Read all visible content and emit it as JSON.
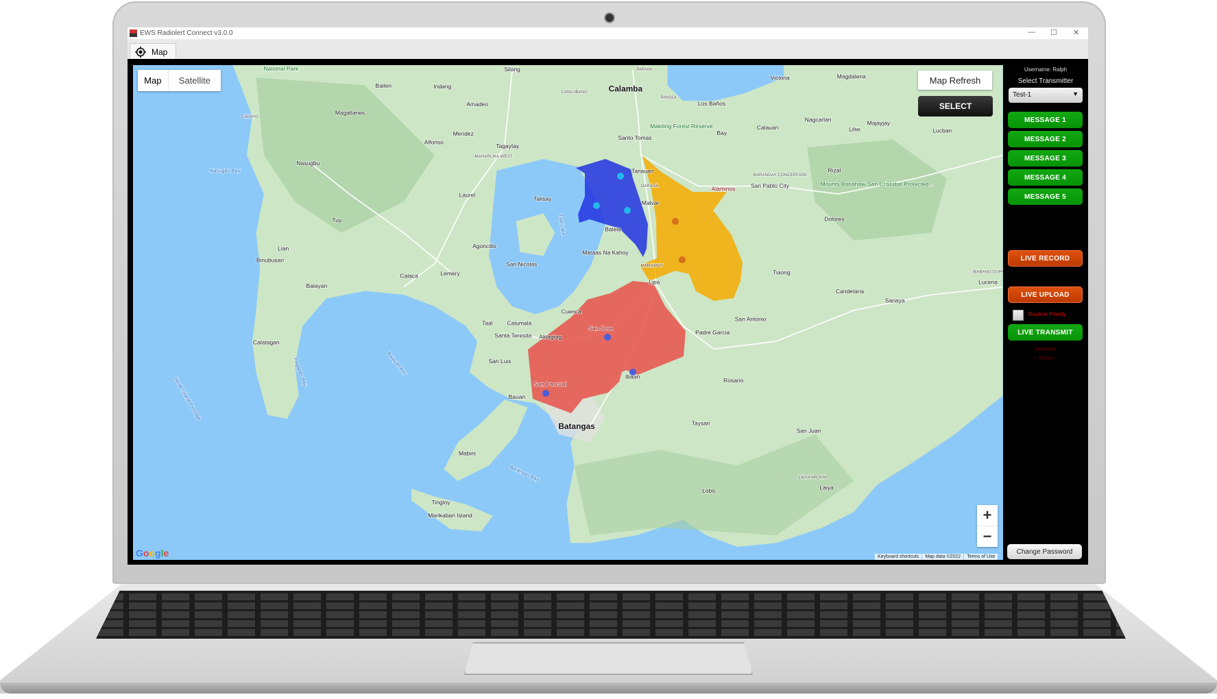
{
  "window": {
    "title": "EWS Radiolert Connect v3.0.0",
    "controls": {
      "minimize": "—",
      "maximize": "☐",
      "close": "✕"
    },
    "tabs": [
      {
        "label": "Map",
        "icon": "crosshair-target-icon",
        "active": true
      }
    ]
  },
  "map": {
    "type_control": {
      "map": "Map",
      "satellite": "Satellite",
      "selected": "Map"
    },
    "refresh_label": "Map Refresh",
    "select_label": "SELECT",
    "zoom_in": "+",
    "zoom_out": "−",
    "attribution": [
      "Keyboard shortcuts",
      "Map data ©2022",
      "Terms of Use"
    ],
    "provider_logo": "Google",
    "colors": {
      "water": "#8cc9f8",
      "land": "#cde6c6",
      "zone_blue": "#2233e0",
      "zone_orange": "#f5aa00",
      "zone_red": "#e8514a"
    },
    "labels": [
      "National Park",
      "Silang",
      "Bailen",
      "Indang",
      "Calamba",
      "PARIAN",
      "Victoria",
      "Magdalena",
      "PANSOL",
      "Los Baños",
      "CANLUBANG",
      "Amadeo",
      "Magallanes",
      "CALAYO",
      "Makiling Forest Reserve",
      "Bay",
      "Nagcarlan",
      "Majayjay",
      "Mendez",
      "Alfonso",
      "Tagaytay",
      "Santo Tomas",
      "Calauan",
      "Liliw",
      "Lucban",
      "MAHARLIKA WEST",
      "Nasugbu",
      "Nasugbu Bay",
      "Tanauan",
      "DARASA",
      "Alaminos",
      "BARANGAY CONCEPCION",
      "San Pablo City",
      "Rizal",
      "Mounts Banahaw-San Cristobal Protected...",
      "Laurel",
      "Talisay",
      "Taal Lake",
      "Malvar",
      "Tuy",
      "Dolores",
      "Balete",
      "Agoncillo",
      "Lian",
      "Mataas Na Kahoy",
      "Binubusan",
      "San Nicolas",
      "Lemery",
      "Calaca",
      "Tiaong",
      "MARAWOY",
      "Lipa",
      "Balayan",
      "Candelaria",
      "Sariaya",
      "IBABANG DUPAY",
      "Lucena",
      "Cuenca",
      "San Antonio",
      "Taal",
      "Calumala",
      "Santa Teresita",
      "Alitagtag",
      "San Jose",
      "Padre Garcia",
      "Calatagan",
      "Balayan Bay",
      "San Luis",
      "Ibaan",
      "Rosario",
      "San Pascual",
      "Pagapas Bay",
      "Verde Island Passage",
      "Bauan",
      "Batangas",
      "Taysan",
      "San Juan",
      "Mabini",
      "Batangas Bay",
      "LAIYA APLAYA",
      "Laiya",
      "Lobo",
      "Tingloy",
      "Marikaban Island"
    ]
  },
  "panel": {
    "username": "Username: Ralph",
    "select_transmitter_label": "Select Transmitter",
    "transmitter_value": "Test-1",
    "messages": [
      "MESSAGE 1",
      "MESSAGE 2",
      "MESSAGE 3",
      "MESSAGE 4",
      "MESSAGE 5"
    ],
    "live_record": "LIVE RECORD",
    "live_upload": "LIVE UPLOAD",
    "routine_priority": "Routine Priority",
    "routine_priority_checked": false,
    "live_transmit": "LIVE TRANSMIT",
    "selected_label": "Selected:",
    "selected_value": "< None >",
    "change_password": "Change Password"
  }
}
